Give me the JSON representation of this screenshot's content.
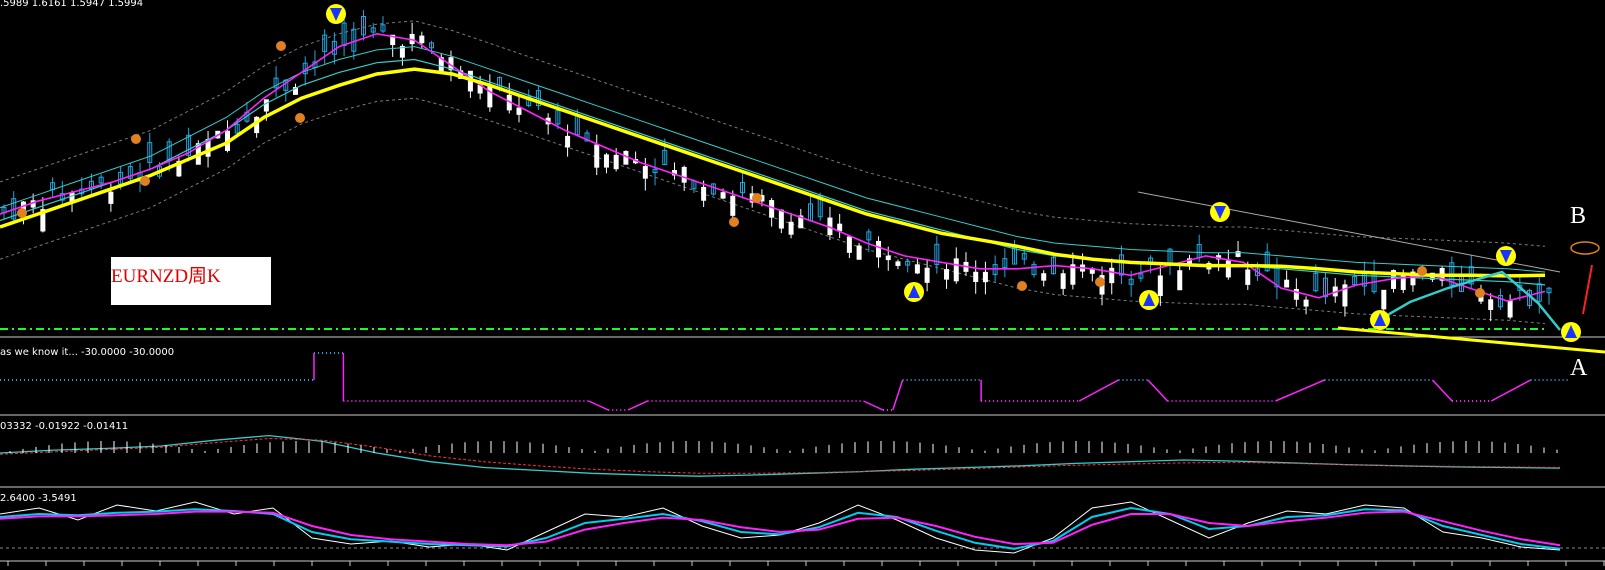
{
  "header": {
    "ohlc_text": ".5989 1.6161 1.5947 1.5994",
    "symbol_label": "EURNZD周K",
    "label_b": "B",
    "label_a": "A"
  },
  "subpanels": [
    {
      "id": "stepline",
      "title": "as we know it... -30.0000 -30.0000"
    },
    {
      "id": "macd",
      "title": "03332 -0.01922 -0.01411"
    },
    {
      "id": "oscillator",
      "title": "2.6400 -3.5491"
    }
  ],
  "colors": {
    "background": "#000000",
    "ma_slow": "#ffff00",
    "ma_fast": "#ff22ff",
    "ma_mid": "#33cccc",
    "envelope": "#7a7a7a",
    "candle_up": "#1ea7e1",
    "candle_down": "#ffffff",
    "stepline_high": "#1ea7e1",
    "stepline_low": "#ff22ff",
    "macd_line": "#33cccc",
    "signal_line": "#ff3030",
    "osc_white": "#ffffff",
    "osc_cyan": "#00ccee",
    "osc_magenta": "#ff22ff",
    "support_line": "#ffff00",
    "dashed_level": "#1cff1c",
    "annotation_red": "#ff2020",
    "marker_orange": "#e08020"
  },
  "chart_data": {
    "type": "line",
    "title": "EURNZD周K",
    "subtitle": ".5989 1.6161 1.5947 1.5994",
    "grid": false,
    "bar_count": 160,
    "price_panel": {
      "series": [
        {
          "key": "ma_slow",
          "values": [
            0.32,
            0.36,
            0.4,
            0.44,
            0.48,
            0.53,
            0.58,
            0.66,
            0.72,
            0.76,
            0.795,
            0.81,
            0.795,
            0.76,
            0.72,
            0.68,
            0.64,
            0.6,
            0.56,
            0.52,
            0.48,
            0.44,
            0.4,
            0.36,
            0.33,
            0.3,
            0.28,
            0.26,
            0.235,
            0.22,
            0.21,
            0.205,
            0.2,
            0.2,
            0.198,
            0.19,
            0.18,
            0.175,
            0.17,
            0.17,
            0.168,
            0.17
          ]
        },
        {
          "key": "ma_fast",
          "values": [
            0.36,
            0.4,
            0.43,
            0.46,
            0.5,
            0.55,
            0.62,
            0.72,
            0.8,
            0.88,
            0.92,
            0.9,
            0.82,
            0.74,
            0.68,
            0.62,
            0.57,
            0.52,
            0.48,
            0.44,
            0.4,
            0.36,
            0.32,
            0.27,
            0.23,
            0.21,
            0.19,
            0.19,
            0.2,
            0.19,
            0.17,
            0.2,
            0.23,
            0.21,
            0.13,
            0.1,
            0.14,
            0.16,
            0.17,
            0.13,
            0.09,
            0.12
          ]
        },
        {
          "key": "ma_mid",
          "values": [
            0.34,
            0.38,
            0.42,
            0.46,
            0.5,
            0.56,
            0.62,
            0.7,
            0.76,
            0.8,
            0.83,
            0.84,
            0.81,
            0.77,
            0.73,
            0.69,
            0.65,
            0.61,
            0.57,
            0.53,
            0.49,
            0.45,
            0.41,
            0.37,
            0.34,
            0.31,
            0.28,
            0.25,
            0.23,
            0.22,
            0.21,
            0.205,
            0.2,
            0.2,
            0.19,
            0.18,
            0.17,
            0.165,
            0.16,
            0.155,
            0.15,
            0.14
          ]
        }
      ]
    },
    "stepline_panel": {
      "levels": {
        "high": 0.5,
        "low": 0.15,
        "peak": 0.95,
        "trough": 0.0
      },
      "segments": [
        {
          "from": 0,
          "to": 32,
          "state": "high"
        },
        {
          "from": 32,
          "to": 35,
          "state": "peak"
        },
        {
          "from": 35,
          "to": 60,
          "state": "low"
        },
        {
          "from": 62,
          "to": 64,
          "state": "trough"
        },
        {
          "from": 66,
          "to": 88,
          "state": "low"
        },
        {
          "from": 90,
          "to": 91,
          "state": "trough"
        },
        {
          "from": 92,
          "to": 100,
          "state": "high"
        },
        {
          "from": 100,
          "to": 110,
          "state": "low"
        },
        {
          "from": 114,
          "to": 117,
          "state": "high"
        },
        {
          "from": 119,
          "to": 130,
          "state": "low"
        },
        {
          "from": 135,
          "to": 146,
          "state": "high"
        },
        {
          "from": 148,
          "to": 152,
          "state": "low"
        },
        {
          "from": 156,
          "to": 160,
          "state": "high"
        }
      ]
    },
    "macd_panel": {
      "series": [
        {
          "key": "macd",
          "values": [
            0.5,
            0.55,
            0.58,
            0.62,
            0.72,
            0.8,
            0.7,
            0.5,
            0.35,
            0.25,
            0.2,
            0.15,
            0.12,
            0.1,
            0.12,
            0.15,
            0.18,
            0.22,
            0.25,
            0.28,
            0.32,
            0.35,
            0.38,
            0.36,
            0.33,
            0.3,
            0.28,
            0.26,
            0.25,
            0.24
          ]
        },
        {
          "key": "signal",
          "values": [
            0.48,
            0.52,
            0.56,
            0.6,
            0.68,
            0.75,
            0.72,
            0.6,
            0.45,
            0.35,
            0.28,
            0.22,
            0.18,
            0.15,
            0.15,
            0.16,
            0.18,
            0.2,
            0.23,
            0.26,
            0.29,
            0.31,
            0.33,
            0.34,
            0.32,
            0.3,
            0.28,
            0.27,
            0.26,
            0.25
          ]
        }
      ]
    },
    "oscillator_panel": {
      "series": [
        {
          "key": "osc_white",
          "values": [
            0.7,
            0.8,
            0.6,
            0.85,
            0.75,
            0.9,
            0.7,
            0.8,
            0.3,
            0.2,
            0.25,
            0.15,
            0.2,
            0.1,
            0.4,
            0.7,
            0.65,
            0.8,
            0.5,
            0.3,
            0.35,
            0.55,
            0.85,
            0.6,
            0.3,
            0.1,
            0.05,
            0.3,
            0.8,
            0.9,
            0.6,
            0.3,
            0.55,
            0.75,
            0.7,
            0.85,
            0.8,
            0.4,
            0.3,
            0.15,
            0.1
          ]
        },
        {
          "key": "osc_cyan",
          "values": [
            0.65,
            0.7,
            0.68,
            0.72,
            0.74,
            0.78,
            0.75,
            0.7,
            0.4,
            0.28,
            0.24,
            0.2,
            0.18,
            0.16,
            0.3,
            0.55,
            0.62,
            0.7,
            0.58,
            0.4,
            0.36,
            0.48,
            0.72,
            0.65,
            0.42,
            0.22,
            0.12,
            0.25,
            0.65,
            0.8,
            0.7,
            0.45,
            0.5,
            0.65,
            0.68,
            0.78,
            0.76,
            0.5,
            0.35,
            0.2,
            0.12
          ]
        },
        {
          "key": "osc_magenta",
          "values": [
            0.62,
            0.66,
            0.66,
            0.68,
            0.7,
            0.74,
            0.74,
            0.72,
            0.5,
            0.35,
            0.28,
            0.24,
            0.2,
            0.18,
            0.24,
            0.44,
            0.55,
            0.64,
            0.6,
            0.48,
            0.4,
            0.44,
            0.62,
            0.64,
            0.5,
            0.32,
            0.2,
            0.22,
            0.52,
            0.7,
            0.7,
            0.55,
            0.5,
            0.58,
            0.64,
            0.72,
            0.74,
            0.58,
            0.42,
            0.28,
            0.18
          ]
        }
      ]
    }
  }
}
